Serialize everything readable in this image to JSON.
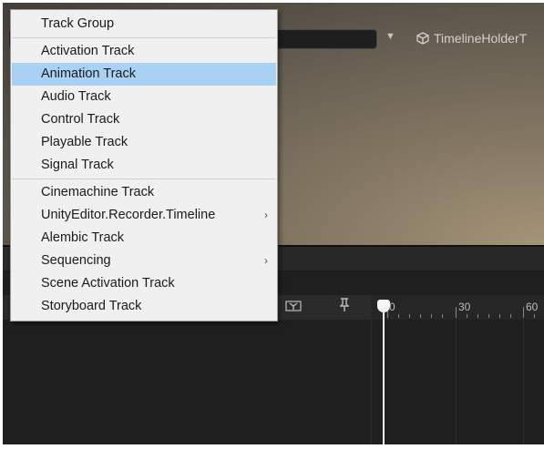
{
  "menu": {
    "items": [
      {
        "label": "Track Group"
      },
      {
        "label": "Activation Track"
      },
      {
        "label": "Animation Track",
        "highlighted": true
      },
      {
        "label": "Audio Track"
      },
      {
        "label": "Control Track"
      },
      {
        "label": "Playable Track"
      },
      {
        "label": "Signal Track"
      },
      {
        "label": "Cinemachine Track"
      },
      {
        "label": "UnityEditor.Recorder.Timeline",
        "submenu": true
      },
      {
        "label": "Alembic Track"
      },
      {
        "label": "Sequencing",
        "submenu": true
      },
      {
        "label": "Scene Activation Track"
      },
      {
        "label": "Storyboard Track"
      }
    ],
    "submenu_glyph": "›",
    "highlight_color": "#a9d1f4"
  },
  "toolbar": {
    "dropdown_glyph": "▼",
    "timeline_object": "TimelineHolderT",
    "object_icon": "cube-icon"
  },
  "ruler": {
    "labels": [
      "0",
      "30",
      "60"
    ]
  },
  "track_header": {
    "lock_icon": "lock-toggle-icon",
    "pin_icon": "pin-icon"
  }
}
